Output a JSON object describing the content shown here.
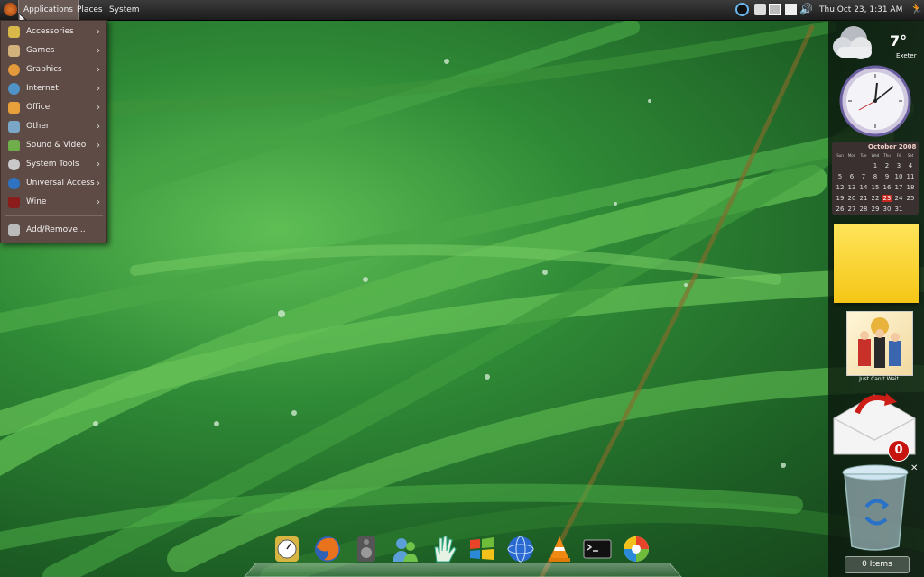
{
  "top_panel": {
    "menus": [
      {
        "label": "Applications"
      },
      {
        "label": "Places"
      },
      {
        "label": "System"
      }
    ],
    "clock": "Thu Oct 23,  1:31 AM",
    "tray_icons": [
      "network-icon",
      "clipboard-icon",
      "display-icon",
      "mail-icon",
      "volume-icon"
    ]
  },
  "applications_menu": {
    "items": [
      {
        "label": "Accessories",
        "icon": "accessories-icon",
        "color": "#d9b84a"
      },
      {
        "label": "Games",
        "icon": "games-icon",
        "color": "#d2b27a"
      },
      {
        "label": "Graphics",
        "icon": "graphics-icon",
        "color": "#e39a3a"
      },
      {
        "label": "Internet",
        "icon": "internet-icon",
        "color": "#4f93c8"
      },
      {
        "label": "Office",
        "icon": "office-icon",
        "color": "#e8a03a"
      },
      {
        "label": "Other",
        "icon": "other-icon",
        "color": "#7aa6c8"
      },
      {
        "label": "Sound & Video",
        "icon": "sound-video-icon",
        "color": "#6fae4a"
      },
      {
        "label": "System Tools",
        "icon": "system-tools-icon",
        "color": "#c9c9c9"
      },
      {
        "label": "Universal Access",
        "icon": "universal-access-icon",
        "color": "#2f72c0"
      },
      {
        "label": "Wine",
        "icon": "wine-icon",
        "color": "#8a1c1c"
      }
    ],
    "footer_item": {
      "label": "Add/Remove...",
      "icon": "add-remove-icon",
      "color": "#bbbbbb"
    }
  },
  "widgets": {
    "weather": {
      "temperature": "7°",
      "city": "Exeter"
    },
    "calendar": {
      "month": "October 2008",
      "day_headers": [
        "Sun",
        "Mon",
        "Tue",
        "Wed",
        "Thu",
        "Fri",
        "Sat"
      ],
      "weeks": [
        [
          "",
          "",
          "",
          "1",
          "2",
          "3",
          "4"
        ],
        [
          "5",
          "6",
          "7",
          "8",
          "9",
          "10",
          "11"
        ],
        [
          "12",
          "13",
          "14",
          "15",
          "16",
          "17",
          "18"
        ],
        [
          "19",
          "20",
          "21",
          "22",
          "23",
          "24",
          "25"
        ],
        [
          "26",
          "27",
          "28",
          "29",
          "30",
          "31",
          ""
        ]
      ],
      "today": "23"
    },
    "album": {
      "title": "Just Can't Wait"
    },
    "mail": {
      "count": "0"
    },
    "trash": {
      "label": "0 Items"
    }
  },
  "dock": {
    "items": [
      "clock-app-icon",
      "firefox-icon",
      "speaker-icon",
      "messenger-icon",
      "hand-icon",
      "windows-icon",
      "globe-icon",
      "vlc-icon",
      "terminal-icon",
      "picasa-icon"
    ]
  },
  "colors": {
    "panel": "#2a2a2a",
    "menu_bg": "#5e4b45",
    "accent_today": "#c8281e",
    "note": "#f5c616"
  }
}
